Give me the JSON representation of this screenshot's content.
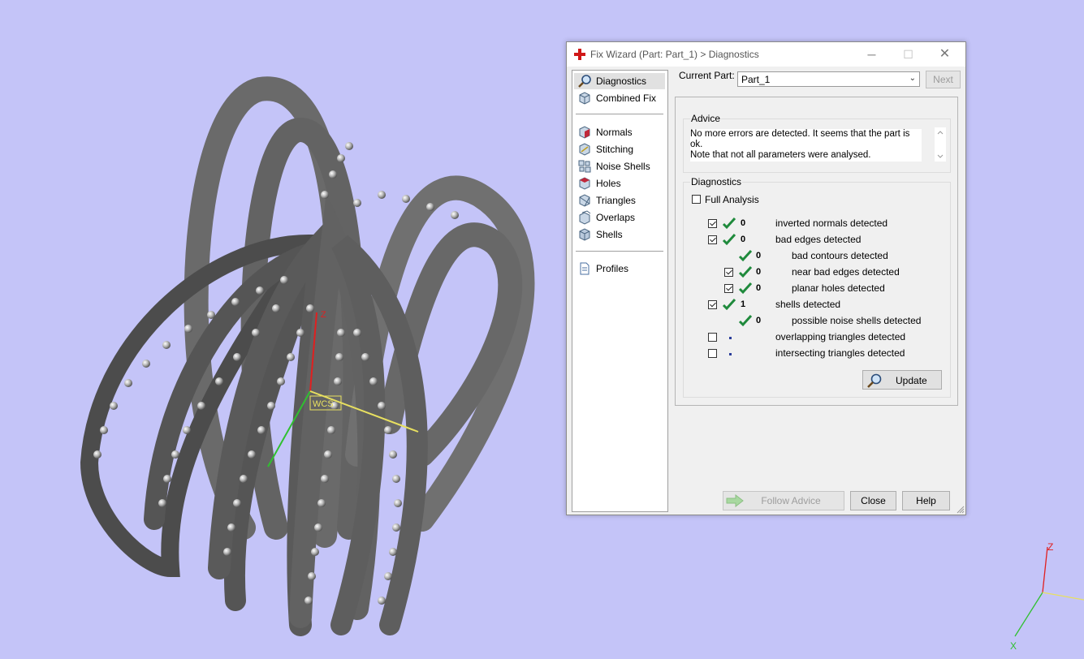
{
  "dialog": {
    "title": "Fix Wizard (Part: Part_1) > Diagnostics",
    "window_buttons": {
      "minimize": "─",
      "maximize": "☐",
      "close": "✕"
    }
  },
  "nav": {
    "group1": [
      {
        "label": "Diagnostics",
        "icon": "magnifier-icon",
        "selected": true
      },
      {
        "label": "Combined Fix",
        "icon": "cube-icon"
      }
    ],
    "group2": [
      {
        "label": "Normals",
        "icon": "normals-cube-icon"
      },
      {
        "label": "Stitching",
        "icon": "stitching-cube-icon"
      },
      {
        "label": "Noise Shells",
        "icon": "noise-shells-icon"
      },
      {
        "label": "Holes",
        "icon": "holes-cube-icon"
      },
      {
        "label": "Triangles",
        "icon": "triangles-cube-icon"
      },
      {
        "label": "Overlaps",
        "icon": "overlaps-cube-icon"
      },
      {
        "label": "Shells",
        "icon": "shells-cube-icon"
      }
    ],
    "group3": [
      {
        "label": "Profiles",
        "icon": "document-icon"
      }
    ]
  },
  "current_part": {
    "label": "Current Part:",
    "value": "Part_1",
    "next_label": "Next"
  },
  "advice": {
    "title": "Advice",
    "text_line1": "No more errors are detected. It seems that the part is ok.",
    "text_line2": "Note that not all parameters were analysed."
  },
  "diagnostics": {
    "title": "Diagnostics",
    "full_analysis_label": "Full Analysis",
    "rows": [
      {
        "checkbox": true,
        "checked": true,
        "status": "ok",
        "count": "0",
        "label": "inverted normals detected",
        "indent": 0
      },
      {
        "checkbox": true,
        "checked": true,
        "status": "ok",
        "count": "0",
        "label": "bad edges detected",
        "indent": 0
      },
      {
        "checkbox": false,
        "checked": false,
        "status": "ok",
        "count": "0",
        "label": "bad contours detected",
        "indent": 1
      },
      {
        "checkbox": true,
        "checked": true,
        "status": "ok",
        "count": "0",
        "label": "near bad edges detected",
        "indent": 1
      },
      {
        "checkbox": true,
        "checked": true,
        "status": "ok",
        "count": "0",
        "label": "planar holes detected",
        "indent": 1
      },
      {
        "checkbox": true,
        "checked": true,
        "status": "ok",
        "count": "1",
        "label": "shells detected",
        "indent": 0
      },
      {
        "checkbox": false,
        "checked": false,
        "status": "ok",
        "count": "0",
        "label": "possible noise shells detected",
        "indent": 1
      },
      {
        "checkbox": true,
        "checked": false,
        "status": "pending",
        "count": "",
        "label": "overlapping triangles detected",
        "indent": 0
      },
      {
        "checkbox": true,
        "checked": false,
        "status": "pending",
        "count": "",
        "label": "intersecting triangles detected",
        "indent": 0
      }
    ],
    "update_label": "Update"
  },
  "footer": {
    "follow_advice_label": "Follow Advice",
    "close_label": "Close",
    "help_label": "Help"
  },
  "viewport": {
    "background": "#c4c4f8",
    "local_axis_z": "Z",
    "local_axis_label": "WCS",
    "world_axis_z": "Z",
    "world_axis_x": "X"
  },
  "colors": {
    "check_green": "#1f8a3c",
    "axis_red": "#e02020",
    "axis_green": "#30c030",
    "axis_yellow": "#e8e060"
  }
}
